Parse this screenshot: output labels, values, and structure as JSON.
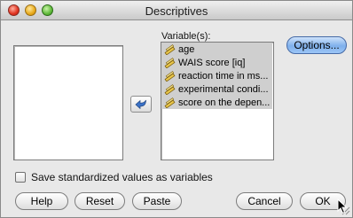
{
  "window": {
    "title": "Descriptives"
  },
  "source_list": {
    "items": []
  },
  "variables": {
    "label": "Variable(s):",
    "items": [
      {
        "label": "age",
        "icon": "ruler-pencil-icon"
      },
      {
        "label": "WAIS score [iq]",
        "icon": "ruler-pencil-icon"
      },
      {
        "label": "reaction time in ms...",
        "icon": "ruler-pencil-icon"
      },
      {
        "label": "experimental condi...",
        "icon": "ruler-pencil-icon"
      },
      {
        "label": "score on the depen...",
        "icon": "ruler-pencil-icon"
      }
    ]
  },
  "move_button": {
    "icon": "arrow-left-icon"
  },
  "options_button": {
    "label": "Options..."
  },
  "save_standardized": {
    "label": "Save standardized values as variables",
    "checked": false
  },
  "buttons": {
    "help": "Help",
    "reset": "Reset",
    "paste": "Paste",
    "cancel": "Cancel",
    "ok": "OK"
  },
  "colors": {
    "accent": "#7fb0ec",
    "selection": "#cfcfcf"
  }
}
